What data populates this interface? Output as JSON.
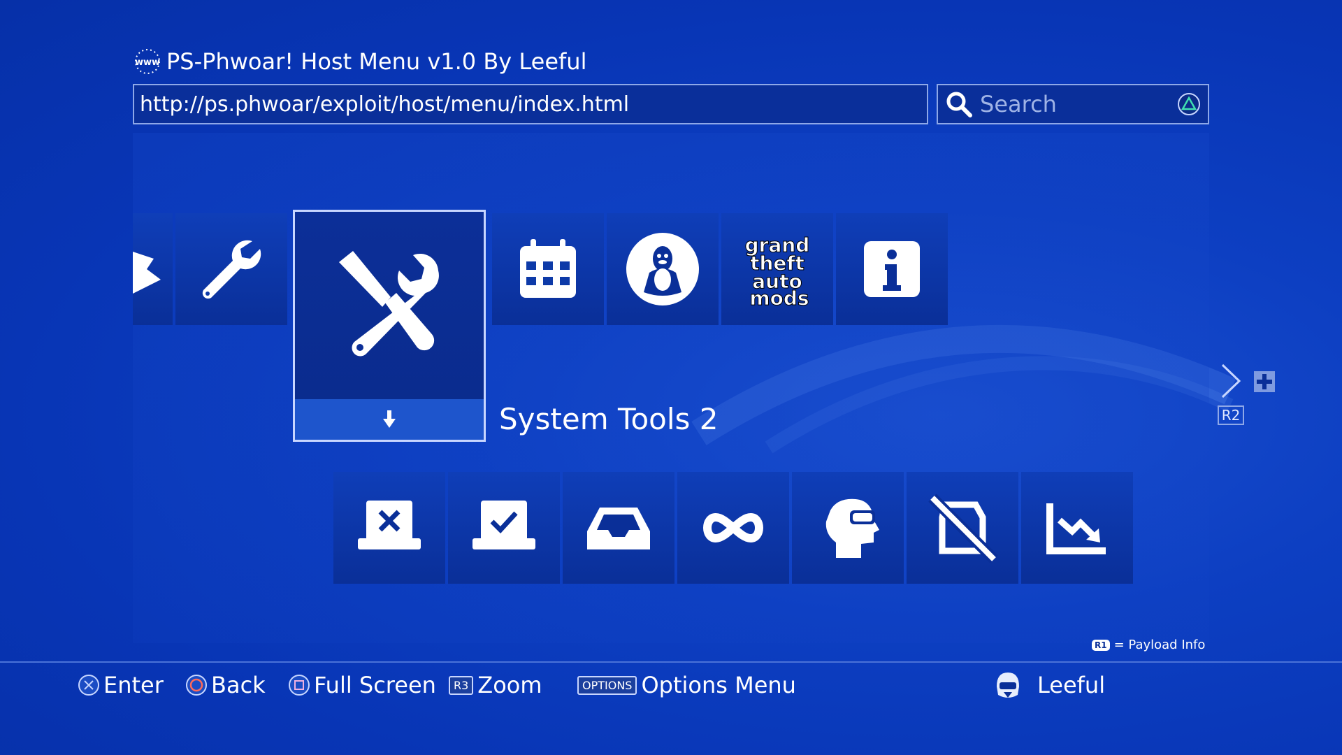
{
  "header": {
    "title": "PS-Phwoar! Host Menu v1.0 By Leeful",
    "url": "http://ps.phwoar/exploit/host/menu/index.html",
    "search_placeholder": "Search"
  },
  "top_row": {
    "selected_label": "System Tools 2",
    "items": [
      {
        "icon": "partial-icon"
      },
      {
        "icon": "wrench-icon"
      },
      {
        "icon": "tools-icon",
        "selected": true
      },
      {
        "icon": "calendar-icon"
      },
      {
        "icon": "linux-tux-icon"
      },
      {
        "icon": "gta-mods-logo"
      },
      {
        "icon": "info-icon"
      }
    ],
    "gta_logo_text": "grand theft auto mods"
  },
  "bottom_row": {
    "items": [
      {
        "icon": "tray-x-icon"
      },
      {
        "icon": "tray-check-icon"
      },
      {
        "icon": "inbox-icon"
      },
      {
        "icon": "infinity-icon"
      },
      {
        "icon": "head-vr-icon"
      },
      {
        "icon": "disabled-device-icon"
      },
      {
        "icon": "chart-down-icon"
      }
    ]
  },
  "nav": {
    "r2_label": "R2"
  },
  "payload_info": {
    "button": "R1",
    "text": "= Payload Info"
  },
  "footer": {
    "enter": "Enter",
    "back": "Back",
    "full_screen": "Full Screen",
    "r3_tag": "R3",
    "zoom": "Zoom",
    "options_tag": "OPTIONS",
    "options_menu": "Options Menu",
    "user": "Leeful"
  },
  "colors": {
    "background": "#0835b5",
    "accent": "#1e55cc",
    "border": "#8ea8e8"
  }
}
